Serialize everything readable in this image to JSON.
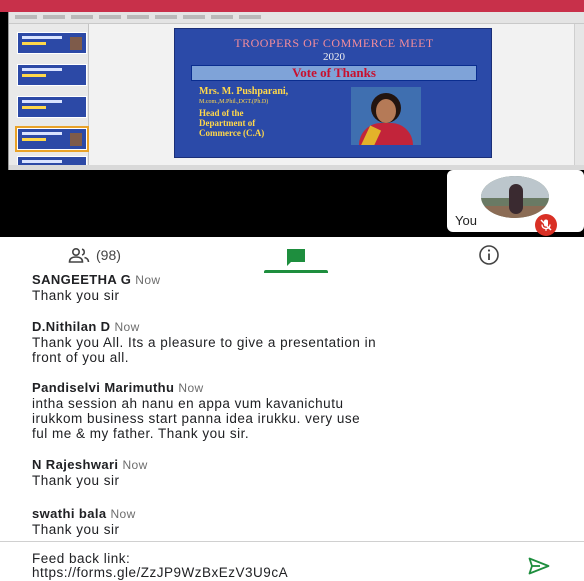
{
  "presentation": {
    "slide_title": "TROOPERS OF COMMERCE MEET",
    "slide_year": "2020",
    "slide_banner": "Vote of Thanks",
    "presenter_name": "Mrs. M. Pushparani,",
    "presenter_quals": "M.com.,M.Phil.,DGT.(Ph.D)",
    "presenter_role": "Head of the\nDepartment of\nCommerce (C.A)"
  },
  "self_view": {
    "label": "You",
    "mic_icon": "mic-off-icon"
  },
  "tabs": {
    "people_count": "(98)",
    "people_icon": "people-icon",
    "chat_icon": "chat-icon",
    "info_icon": "info-icon"
  },
  "messages": [
    {
      "sender": "SANGEETHA G",
      "time": "Now",
      "text": "Thank you sir"
    },
    {
      "sender": "D.Nithilan D",
      "time": "Now",
      "text": "Thank you All. Its a pleasure to give a presentation in\nfront of you all."
    },
    {
      "sender": "Pandiselvi Marimuthu",
      "time": "Now",
      "text": "intha session ah nanu en appa vum kavanichutu\nirukkom  business start  panna idea irukku.  very use\nful me & my father. Thank you sir."
    },
    {
      "sender": "N Rajeshwari",
      "time": "Now",
      "text": "Thank you sir"
    },
    {
      "sender": "swathi bala",
      "time": "Now",
      "text": "Thank you sir"
    }
  ],
  "composer": {
    "text": "Feed back link:\nhttps://forms.gle/ZzJP9WzBxEzV3U9cA",
    "send_icon": "send-icon"
  },
  "colors": {
    "accent_green": "#1e8e3e",
    "mic_red": "#d93025",
    "slide_blue": "#2b4aa8"
  }
}
